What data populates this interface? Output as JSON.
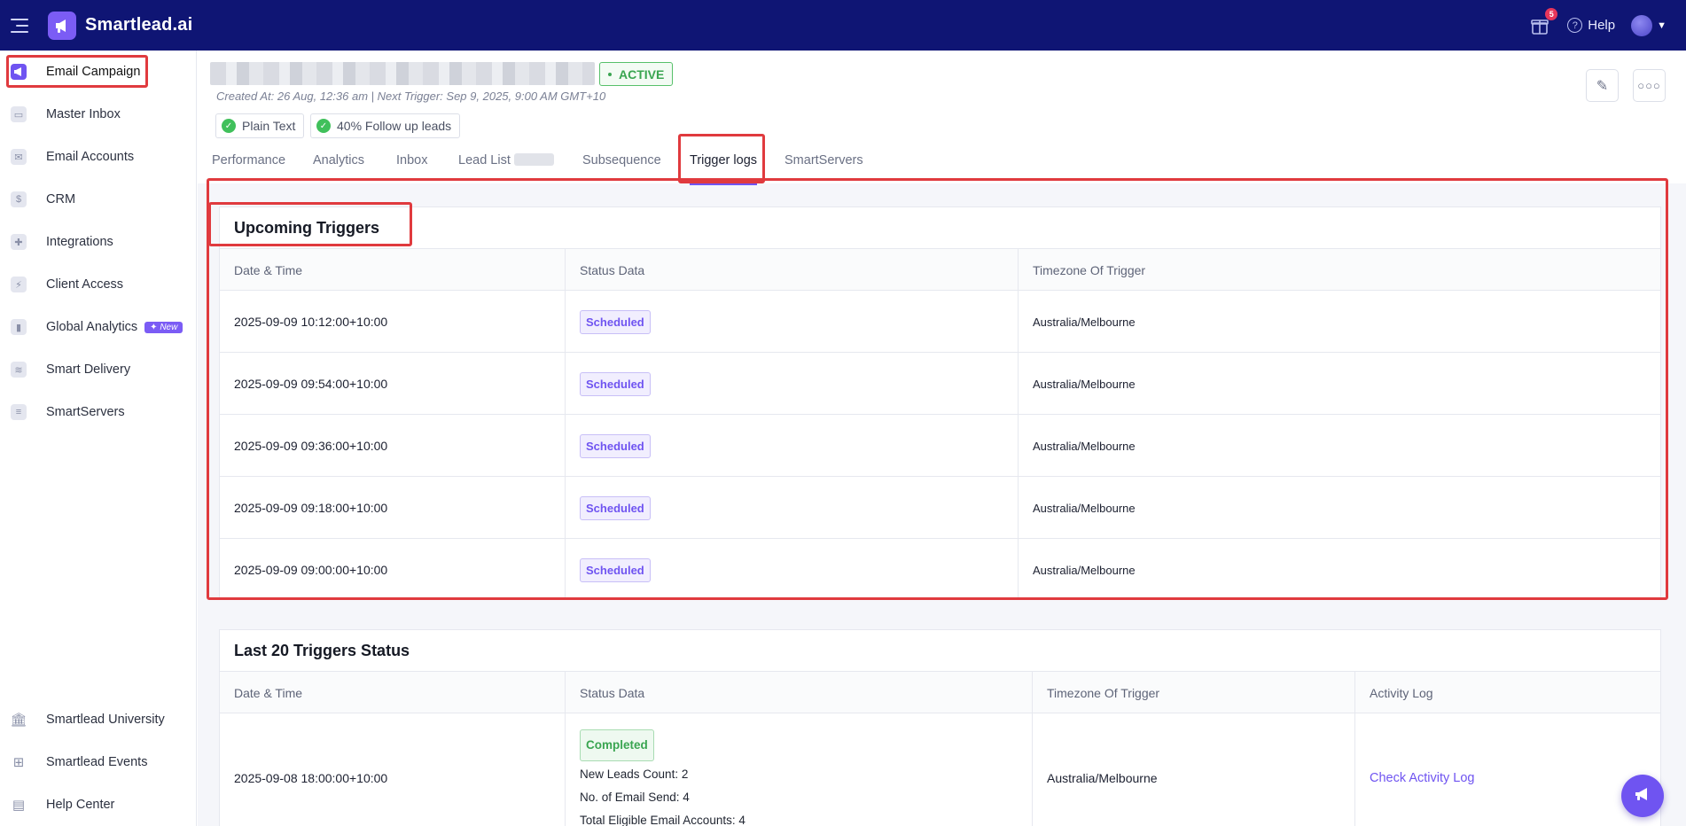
{
  "app": {
    "name": "Smartlead.ai",
    "gift_count": "5",
    "help_label": "Help"
  },
  "sidebar": {
    "items": [
      {
        "label": "Email Campaign",
        "icon": "megaphone-icon"
      },
      {
        "label": "Master Inbox",
        "icon": "inbox-icon"
      },
      {
        "label": "Email Accounts",
        "icon": "envelope-icon"
      },
      {
        "label": "CRM",
        "icon": "dollar-icon"
      },
      {
        "label": "Integrations",
        "icon": "puzzle-icon"
      },
      {
        "label": "Client Access",
        "icon": "bolt-icon"
      },
      {
        "label": "Global Analytics",
        "icon": "bar-chart-icon",
        "badge": "✦ New"
      },
      {
        "label": "Smart Delivery",
        "icon": "layers-icon"
      },
      {
        "label": "SmartServers",
        "icon": "server-icon"
      }
    ],
    "bottom": [
      {
        "label": "Smartlead University",
        "icon": "bank-icon"
      },
      {
        "label": "Smartlead Events",
        "icon": "grid-icon"
      },
      {
        "label": "Help Center",
        "icon": "book-icon"
      }
    ]
  },
  "campaign": {
    "status": "ACTIVE",
    "meta": "Created At: 26 Aug, 12:36 am | Next Trigger: Sep 9, 2025, 9:00 AM GMT+10",
    "chips": [
      "Plain Text",
      "40% Follow up leads"
    ]
  },
  "tabs": [
    "Performance",
    "Analytics",
    "Inbox",
    "Lead List",
    "Subsequence",
    "Trigger logs",
    "SmartServers"
  ],
  "upcoming": {
    "title": "Upcoming Triggers",
    "headers": [
      "Date & Time",
      "Status Data",
      "Timezone Of Trigger"
    ],
    "rows": [
      {
        "datetime": "2025-09-09 10:12:00+10:00",
        "status": "Scheduled",
        "timezone": "Australia/Melbourne"
      },
      {
        "datetime": "2025-09-09 09:54:00+10:00",
        "status": "Scheduled",
        "timezone": "Australia/Melbourne"
      },
      {
        "datetime": "2025-09-09 09:36:00+10:00",
        "status": "Scheduled",
        "timezone": "Australia/Melbourne"
      },
      {
        "datetime": "2025-09-09 09:18:00+10:00",
        "status": "Scheduled",
        "timezone": "Australia/Melbourne"
      },
      {
        "datetime": "2025-09-09 09:00:00+10:00",
        "status": "Scheduled",
        "timezone": "Australia/Melbourne"
      }
    ]
  },
  "last20": {
    "title": "Last 20 Triggers Status",
    "headers": [
      "Date & Time",
      "Status Data",
      "Timezone Of Trigger",
      "Activity Log"
    ],
    "rows": [
      {
        "datetime": "2025-09-08 18:00:00+10:00",
        "status": "Completed",
        "details": [
          "New Leads Count: 2",
          "No. of Email Send: 4",
          "Total Eligible Email Accounts: 4"
        ],
        "timezone": "Australia/Melbourne",
        "activity": "Check Activity Log"
      }
    ]
  }
}
